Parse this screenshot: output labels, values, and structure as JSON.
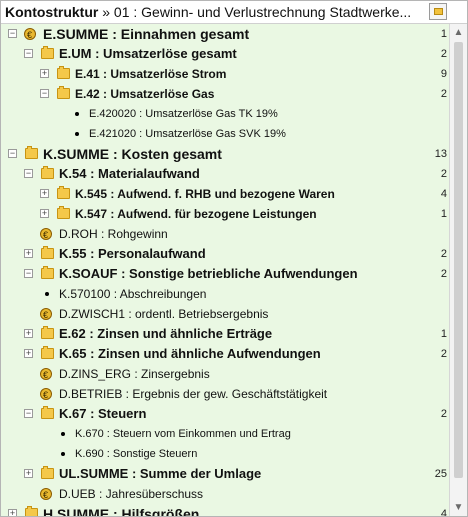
{
  "header": {
    "title": "Kontostruktur",
    "separator": " » ",
    "path": "01 : Gewinn- und Verlustrechnung Stadtwerke..."
  },
  "rows": [
    {
      "label": "E.SUMME : Einnahmen gesamt",
      "count": "1"
    },
    {
      "label": "E.UM : Umsatzerlöse  gesamt",
      "count": "2"
    },
    {
      "label": "E.41 : Umsatzerlöse Strom",
      "count": "9"
    },
    {
      "label": "E.42 : Umsatzerlöse Gas",
      "count": "2"
    },
    {
      "label": "E.420020 : Umsatzerlöse Gas TK 19%",
      "count": ""
    },
    {
      "label": "E.421020 : Umsatzerlöse Gas SVK 19%",
      "count": ""
    },
    {
      "label": "K.SUMME : Kosten gesamt",
      "count": "13"
    },
    {
      "label": "K.54 : Materialaufwand",
      "count": "2"
    },
    {
      "label": "K.545 : Aufwend. f. RHB und bezogene Waren",
      "count": "4"
    },
    {
      "label": "K.547 : Aufwend. für bezogene Leistungen",
      "count": "1"
    },
    {
      "label": "D.ROH : Rohgewinn",
      "count": ""
    },
    {
      "label": "K.55 : Personalaufwand",
      "count": "2"
    },
    {
      "label": "K.SOAUF : Sonstige  betriebliche  Aufwendungen",
      "count": "2"
    },
    {
      "label": "K.570100 : Abschreibungen",
      "count": ""
    },
    {
      "label": "D.ZWISCH1 : ordentl. Betriebsergebnis",
      "count": ""
    },
    {
      "label": "E.62 : Zinsen und ähnliche Erträge",
      "count": "1"
    },
    {
      "label": "K.65 : Zinsen und ähnliche Aufwendungen",
      "count": "2"
    },
    {
      "label": "D.ZINS_ERG : Zinsergebnis",
      "count": ""
    },
    {
      "label": "D.BETRIEB : Ergebnis der gew. Geschäftstätigkeit",
      "count": ""
    },
    {
      "label": "K.67 : Steuern",
      "count": "2"
    },
    {
      "label": "K.670 : Steuern vom Einkommen und Ertrag",
      "count": ""
    },
    {
      "label": "K.690 : Sonstige Steuern",
      "count": ""
    },
    {
      "label": "UL.SUMME : Summe der Umlage",
      "count": "25"
    },
    {
      "label": "D.UEB : Jahresüberschuss",
      "count": ""
    },
    {
      "label": "H.SUMME : Hilfsgrößen",
      "count": "4"
    }
  ],
  "colors": {
    "tree_background": "#eaf8e3",
    "folder": "#f4c84a",
    "coin": "#e9b82f"
  },
  "icons": {
    "folder": "folder-icon",
    "coin": "euro-coin-icon",
    "bullet": "bullet-icon",
    "expand": "plus-icon",
    "collapse": "minus-icon"
  }
}
